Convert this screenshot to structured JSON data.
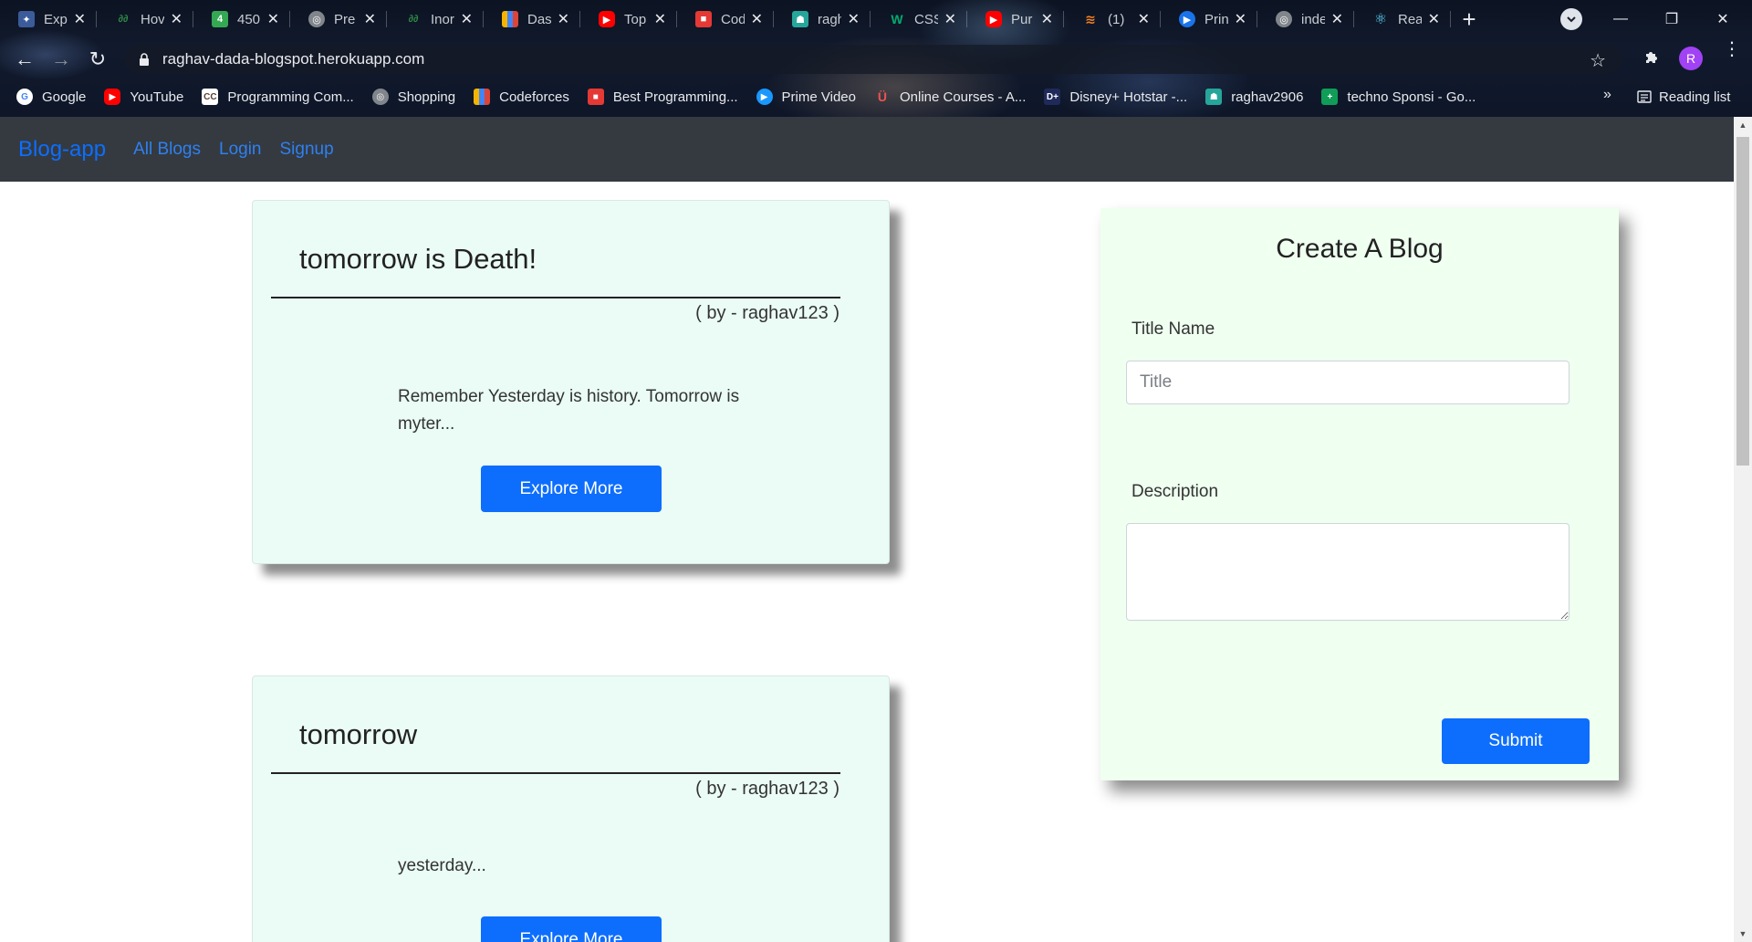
{
  "browser": {
    "tabs": [
      {
        "title": "Exp",
        "icon": "brand-icon",
        "color": "#3b5b9a"
      },
      {
        "title": "Hov",
        "icon": "geeksforgeeks-icon",
        "color": "#2f8d46"
      },
      {
        "title": "450",
        "icon": "sheet-icon",
        "color": "#34a853"
      },
      {
        "title": "Pre",
        "icon": "globe-icon",
        "color": "#80868b"
      },
      {
        "title": "Inor",
        "icon": "geeksforgeeks-icon",
        "color": "#2f8d46"
      },
      {
        "title": "Das",
        "icon": "bar-chart-icon",
        "color": "#f4b400"
      },
      {
        "title": "Top",
        "icon": "youtube-icon",
        "color": "#ff0000"
      },
      {
        "title": "Cod",
        "icon": "cube-icon",
        "color": "#e53935"
      },
      {
        "title": "ragh",
        "icon": "image-icon",
        "color": "#26a69a"
      },
      {
        "title": "CSS",
        "icon": "w3schools-icon",
        "color": "#04aa6d"
      },
      {
        "title": "Pur",
        "icon": "youtube-icon",
        "color": "#ff0000"
      },
      {
        "title": "(1)",
        "icon": "stack-icon",
        "color": "#f48024"
      },
      {
        "title": "Prin",
        "icon": "play-icon",
        "color": "#1a73e8"
      },
      {
        "title": "inde",
        "icon": "globe-icon",
        "color": "#80868b"
      },
      {
        "title": "Rea",
        "icon": "react-icon",
        "color": "#61dafb"
      }
    ],
    "url": "raghav-dada-blogspot.herokuapp.com",
    "profile_initial": "R",
    "bookmarks": [
      {
        "label": "Google",
        "icon": "google-icon",
        "color": "#4285f4"
      },
      {
        "label": "YouTube",
        "icon": "youtube-icon",
        "color": "#ff0000"
      },
      {
        "label": "Programming Com...",
        "icon": "cc-icon",
        "color": "#5d4037"
      },
      {
        "label": "Shopping",
        "icon": "globe-icon",
        "color": "#80868b"
      },
      {
        "label": "Codeforces",
        "icon": "bar-chart-icon",
        "color": "#f4b400"
      },
      {
        "label": "Best Programming...",
        "icon": "cube-icon",
        "color": "#e53935"
      },
      {
        "label": "Prime Video",
        "icon": "play-icon",
        "color": "#1a98ff"
      },
      {
        "label": "Online Courses - A...",
        "icon": "udemy-icon",
        "color": "#ec5252"
      },
      {
        "label": "Disney+ Hotstar -...",
        "icon": "hotstar-icon",
        "color": "#1f2a5a"
      },
      {
        "label": "raghav2906",
        "icon": "image-icon",
        "color": "#26a69a"
      },
      {
        "label": "techno Sponsi - Go...",
        "icon": "sheet-icon",
        "color": "#0f9d58"
      }
    ],
    "bookmarks_overflow": "»",
    "reading_list": "Reading list"
  },
  "app": {
    "brand": "Blog-app",
    "nav": [
      "All Blogs",
      "Login",
      "Signup"
    ]
  },
  "blogs": [
    {
      "title": "tomorrow is Death!",
      "author": "( by - raghav123 )",
      "excerpt": "Remember Yesterday is history. Tomorrow is myter...",
      "button": "Explore More"
    },
    {
      "title": "tomorrow",
      "author": "( by - raghav123 )",
      "excerpt": "yesterday...",
      "button": "Explore More"
    }
  ],
  "create": {
    "heading": "Create A Blog",
    "title_label": "Title Name",
    "title_placeholder": "Title",
    "title_value": "",
    "description_label": "Description",
    "description_value": "",
    "submit": "Submit"
  },
  "colors": {
    "navbar": "#343a40",
    "primary": "#0d6efd",
    "card_bg": "#eafcf5",
    "form_bg": "#effff0"
  }
}
